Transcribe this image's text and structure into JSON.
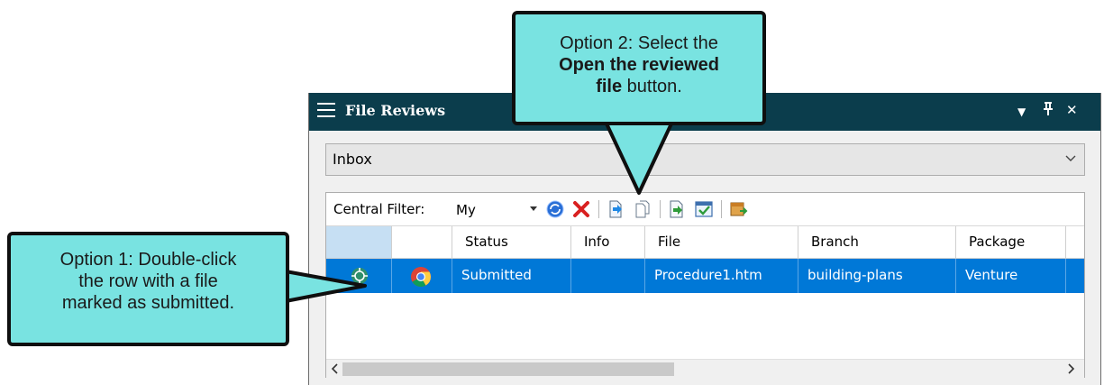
{
  "panel": {
    "title": "File Reviews",
    "controls": {
      "dropdown": "▼",
      "pin": "⊥",
      "close": "✕"
    }
  },
  "view_selector": {
    "value": "Inbox"
  },
  "toolbar": {
    "filter_label": "Central Filter:",
    "filter_value": "My"
  },
  "table": {
    "columns": [
      "",
      "",
      "Status",
      "Info",
      "File",
      "Branch",
      "Package"
    ],
    "rows": [
      {
        "status": "Submitted",
        "info": "",
        "file": "Procedure1.htm",
        "branch": "building-plans",
        "package": "Venture",
        "selected": true
      }
    ]
  },
  "icons": [
    "hamburger-icon",
    "chevron-down-icon",
    "refresh-icon",
    "delete-icon",
    "open-reviewed-file-icon",
    "copy-icon",
    "export-icon",
    "accept-icon",
    "package-icon",
    "review-status-icon",
    "chrome-icon",
    "scroll-left-icon",
    "scroll-right-icon"
  ],
  "callouts": {
    "option1": {
      "line1": "Option 1: Double-click",
      "line2": "the row with a file",
      "line3": "marked as submitted."
    },
    "option2": {
      "line1": "Option 2: Select the",
      "line2": "Open the reviewed",
      "line3_bold": "file",
      "line3_rest": " button."
    }
  },
  "colors": {
    "titlebar": "#0b3d4c",
    "selection": "#0078d7",
    "callout_fill": "#79e3e1"
  }
}
